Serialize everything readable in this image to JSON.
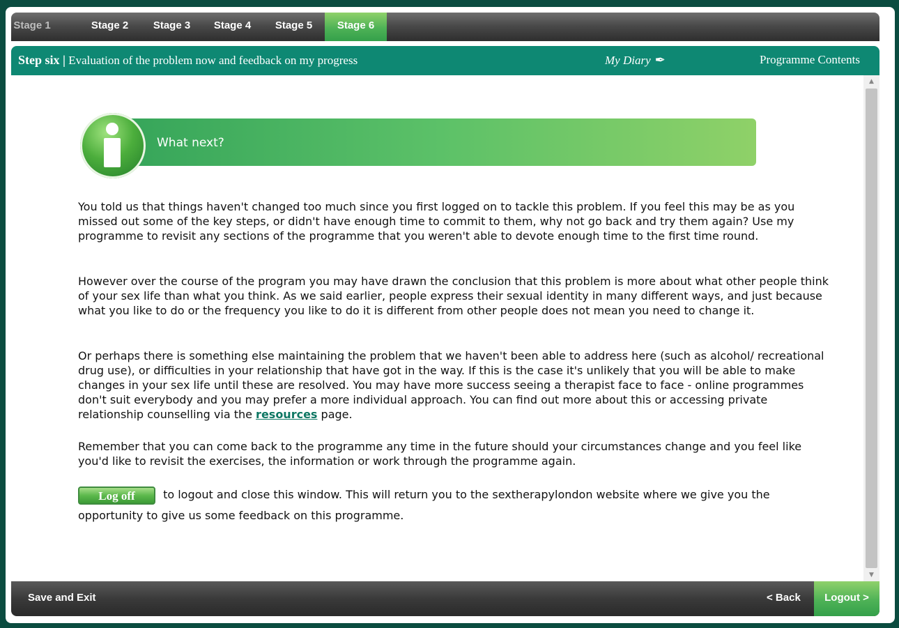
{
  "stages": [
    {
      "label": "Stage 1",
      "state": "muted"
    },
    {
      "label": "Stage 2",
      "state": "normal"
    },
    {
      "label": "Stage 3",
      "state": "normal"
    },
    {
      "label": "Stage 4",
      "state": "normal"
    },
    {
      "label": "Stage 5",
      "state": "normal"
    },
    {
      "label": "Stage 6",
      "state": "active"
    }
  ],
  "header": {
    "step_label": "Step six |",
    "step_title": "Evaluation of the problem now and feedback on my progress",
    "diary_label": "My Diary",
    "diary_icon": "pen-icon",
    "contents_label": "Programme Contents"
  },
  "banner": {
    "title": "What next?",
    "icon": "info-icon"
  },
  "content": {
    "p1": "You told us that things haven't changed too much since you first logged on to tackle this problem. If you feel this may be as you missed out some of the key steps, or didn't have enough time to commit to them, why not go back and try them again? Use my programme to revisit any sections of the programme that you weren't able to devote enough time to the first time round.",
    "p2": "However over the course of the program you may have drawn the conclusion that this problem is more about what other people think of your sex life than what you think. As we said earlier, people express their sexual identity in many different ways, and just because what you like to do or the frequency you like to do it is different from other people does not mean you need to change it.",
    "p3_before": "Or perhaps there is something else maintaining the problem that we haven't been able to address here (such as alcohol/ recreational drug use), or difficulties in your relationship that have got in the way. If this is the case it's unlikely that you will be able to make changes in your sex life until these are resolved. You may have more success seeing a therapist face to face - online programmes don't suit everybody and you may prefer a more individual approach. You can find out more about this or accessing private relationship counselling via the ",
    "p3_link": "resources",
    "p3_after": " page.",
    "p4": "Remember that you can come back to the programme any time in the future should your circumstances change and you feel like you'd like to revisit the exercises, the information or work through the programme again.",
    "logoff_button": "Log off",
    "p5": " to logout and close this window. This will return you to the sextherapylondon website where we give you the opportunity to give us some feedback on this programme."
  },
  "footer": {
    "save_exit": "Save and Exit",
    "back": "< Back",
    "logout": "Logout >"
  },
  "colors": {
    "frame_bg": "#0b4c40",
    "header_teal": "#0e8873",
    "accent_green": "#4eb256",
    "link_teal": "#0e7763"
  }
}
